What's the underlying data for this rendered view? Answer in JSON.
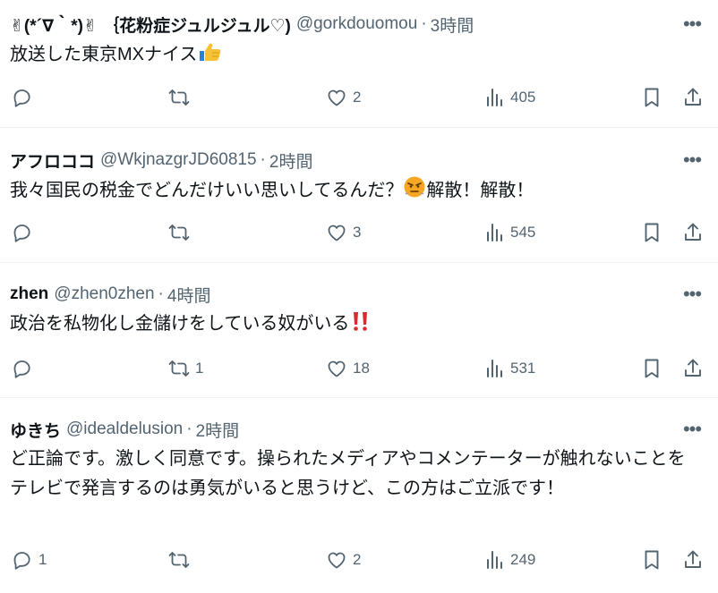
{
  "tweets": [
    {
      "name": "✌(*´∇｀*)✌ ｛花粉症ジュルジュル♡)",
      "handle": "@gorkdouomou",
      "dot": "·",
      "time": "3時間",
      "text_before": "放送した東京MXナイス",
      "emoji": "thumbs-up",
      "text_after": "",
      "reply_count": "",
      "retweet_count": "",
      "like_count": "2",
      "view_count": "405"
    },
    {
      "name": "アフロココ",
      "handle": "@WkjnazgrJD60815",
      "dot": "·",
      "time": "2時間",
      "text_before": "我々国民の税金でどんだけいい思いしてるんだ？",
      "emoji": "angry-face",
      "text_after": "解散！解散！",
      "reply_count": "",
      "retweet_count": "",
      "like_count": "3",
      "view_count": "545"
    },
    {
      "name": "zhen",
      "handle": "@zhen0zhen",
      "dot": "·",
      "time": "4時間",
      "text_before": "政治を私物化し金儲けをしている奴がいる",
      "emoji": "double-exclamation",
      "text_after": "",
      "reply_count": "",
      "retweet_count": "1",
      "like_count": "18",
      "view_count": "531"
    },
    {
      "name": "ゆきち",
      "handle": "@idealdelusion",
      "dot": "·",
      "time": "2時間",
      "text_before": "ど正論です。激しく同意です。操られたメディアやコメンテーターが触れないことをテレビで発言するのは勇気がいると思うけど、この方はご立派です！",
      "emoji": "",
      "text_after": "",
      "reply_count": "1",
      "retweet_count": "",
      "like_count": "2",
      "view_count": "249"
    }
  ],
  "icons": {
    "more": "more-horizontal-icon",
    "reply": "reply-icon",
    "retweet": "retweet-icon",
    "like": "heart-icon",
    "views": "views-bar-chart-icon",
    "bookmark": "bookmark-icon",
    "share": "share-icon"
  },
  "colors": {
    "text": "#0f1419",
    "secondary": "#536471",
    "divider": "#eff3f4"
  }
}
